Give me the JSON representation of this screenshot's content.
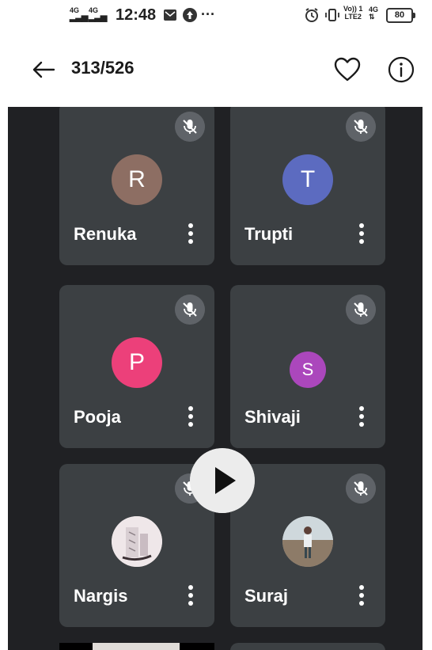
{
  "status_bar": {
    "sim1": "4G",
    "sim2": "4G",
    "time": "12:48",
    "volte_top": "Vo)) 1",
    "volte_bottom": "LTE2",
    "net": "4G",
    "battery": "80",
    "overflow": "···"
  },
  "app_bar": {
    "counter": "313/526"
  },
  "participants": [
    {
      "name": "Renuka",
      "initial": "R",
      "color": "#8d6e63"
    },
    {
      "name": "Trupti",
      "initial": "T",
      "color": "#5c6bc0"
    },
    {
      "name": "Pooja",
      "initial": "P",
      "color": "#ec407a"
    },
    {
      "name": "Shivaji",
      "initial": "S",
      "color": "#ab47bc"
    },
    {
      "name": "Nargis",
      "initial": "",
      "color": "#d7ccc8"
    },
    {
      "name": "Suraj",
      "initial": "",
      "color": "#90a4ae"
    }
  ],
  "icons": {
    "back": "arrow-left-icon",
    "favorite": "heart-icon",
    "info": "info-icon",
    "mute": "mic-off-icon",
    "more": "more-vertical-icon",
    "play": "play-icon"
  }
}
